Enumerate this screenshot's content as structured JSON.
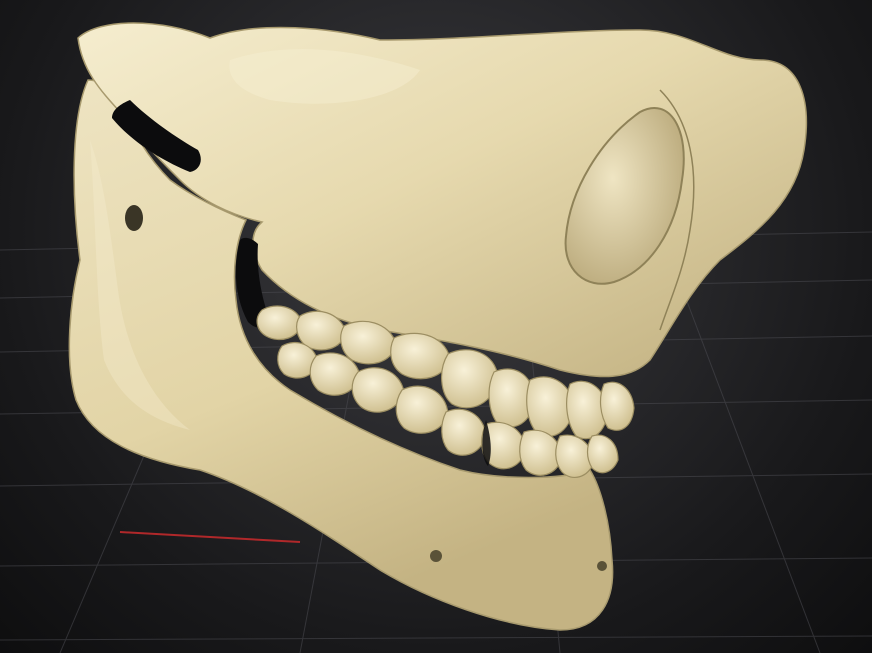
{
  "viewport": {
    "background_top": "#3c3c40",
    "background_bottom": "#0e0e0f",
    "floor_grid_color": "#5a5a60",
    "axis_line_color": "#b0282a"
  },
  "model": {
    "subject": "skull-jaw-sculpt",
    "bone_color": "#e8dcb2",
    "bone_highlight": "#f7efd2",
    "bone_shadow": "#a89a6e",
    "teeth_color": "#ede2bd",
    "cavity_color": "#0c0c0d"
  }
}
